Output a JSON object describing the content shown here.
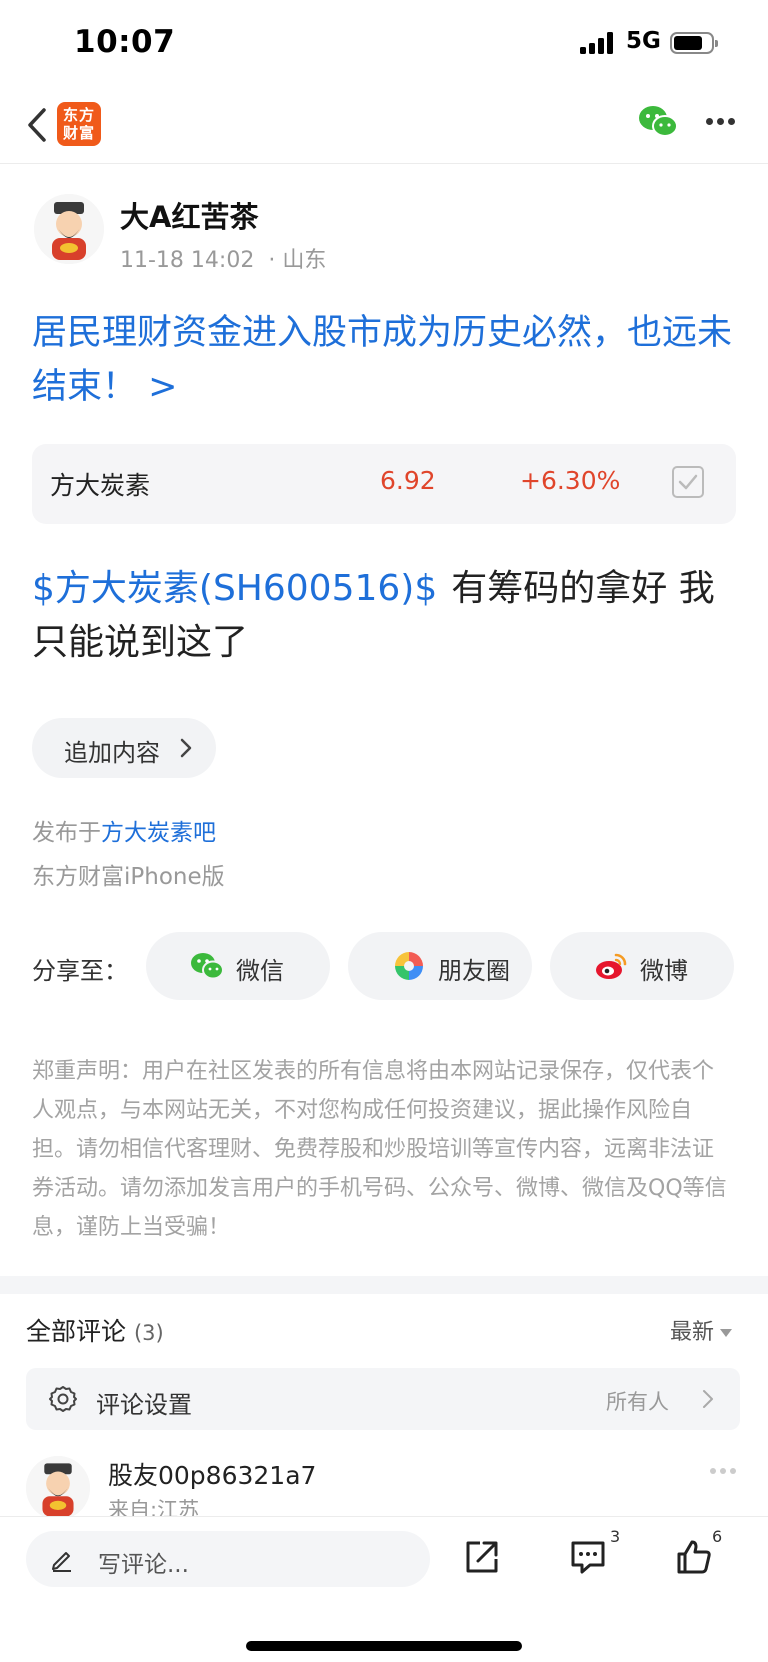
{
  "status_bar": {
    "time": "10:07",
    "network": "5G"
  },
  "nav": {
    "app_logo_line1": "东方",
    "app_logo_line2": "财富"
  },
  "author": {
    "name": "大A红苦茶",
    "timestamp": "11-18 14:02",
    "separator": "·",
    "location": "山东"
  },
  "post": {
    "title": "居民理财资金进入股市成为历史必然，也远未结束！ >",
    "stock_card": {
      "name": "方大炭素",
      "price": "6.92",
      "change": "+6.30%"
    },
    "body_tag": "$方大炭素(SH600516)$",
    "body_text": "有筹码的拿好 我只能说到这了",
    "append_button": "追加内容",
    "published_prefix": "发布于",
    "forum": "方大炭素吧",
    "client": "东方财富iPhone版"
  },
  "share": {
    "label": "分享至：",
    "wechat": "微信",
    "moments": "朋友圈",
    "weibo": "微博"
  },
  "disclaimer": "郑重声明：用户在社区发表的所有信息将由本网站记录保存，仅代表个人观点，与本网站无关，不对您构成任何投资建议，据此操作风险自担。请勿相信代客理财、免费荐股和炒股培训等宣传内容，远离非法证券活动。请勿添加发言用户的手机号码、公众号、微博、微信及QQ等信息，谨防上当受骗！",
  "comments": {
    "title": "全部评论",
    "count": "(3)",
    "sort": "最新",
    "settings_label": "评论设置",
    "settings_value": "所有人",
    "first": {
      "user": "股友00p86321a7",
      "location": "来自:江苏"
    }
  },
  "bottom_bar": {
    "placeholder": "写评论...",
    "comment_count": "3",
    "like_count": "6"
  },
  "colors": {
    "link_blue": "#1e6fd9",
    "price_red": "#e0452b",
    "brand_orange": "#f05a1a"
  }
}
